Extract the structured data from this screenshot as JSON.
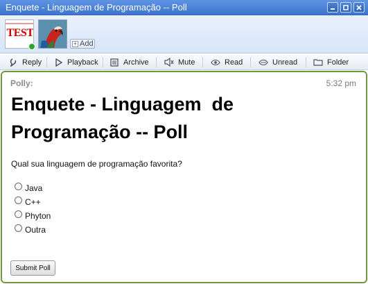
{
  "window": {
    "title": "Enquete - Linguagem de Programação -- Poll",
    "buttons": [
      "minimize",
      "maximize",
      "close"
    ]
  },
  "header": {
    "avatar_text": "TEST",
    "add_label": "Add",
    "status_color": "#2aa52a"
  },
  "toolbar": {
    "items": [
      {
        "label": "Reply",
        "icon": "reply-icon"
      },
      {
        "label": "Playback",
        "icon": "play-icon"
      },
      {
        "label": "Archive",
        "icon": "archive-icon"
      },
      {
        "label": "Mute",
        "icon": "mute-icon"
      },
      {
        "label": "Read",
        "icon": "eye-icon"
      },
      {
        "label": "Unread",
        "icon": "unread-icon"
      },
      {
        "label": "Folder",
        "icon": "folder-icon"
      }
    ]
  },
  "message": {
    "sender": "Polly:",
    "time": "5:32 pm",
    "title": "Enquete - Linguagem  de Programação -- Poll",
    "question": "Qual sua linguagem de programação favorita?",
    "options": [
      "Java",
      "C++",
      "Phyton",
      "Outra"
    ],
    "submit_label": "Submit Poll"
  },
  "colors": {
    "titlebar": "#3f76cf",
    "content_border": "#6f9a3c"
  }
}
